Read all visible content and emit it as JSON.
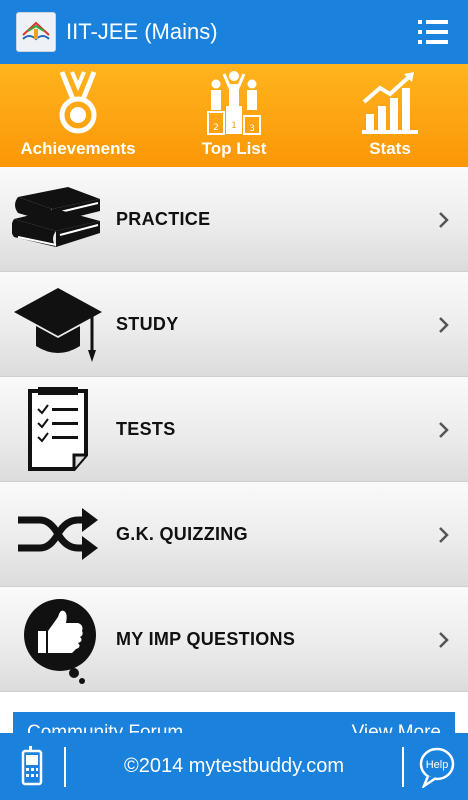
{
  "app": {
    "title": "IIT-JEE (Mains)",
    "colors": {
      "primary": "#1a82dc",
      "accent": "#fb9707",
      "text": "#111111"
    }
  },
  "topnav": {
    "items": [
      {
        "label": "Achievements",
        "icon": "medal-icon"
      },
      {
        "label": "Top List",
        "icon": "podium-icon"
      },
      {
        "label": "Stats",
        "icon": "stats-chart-icon"
      }
    ]
  },
  "menu": {
    "items": [
      {
        "label": "PRACTICE",
        "icon": "books-icon"
      },
      {
        "label": "STUDY",
        "icon": "graduation-cap-icon"
      },
      {
        "label": "TESTS",
        "icon": "clipboard-checklist-icon"
      },
      {
        "label": "G.K. QUIZZING",
        "icon": "shuffle-icon"
      },
      {
        "label": "MY IMP QUESTIONS",
        "icon": "thumbs-up-icon"
      }
    ]
  },
  "community": {
    "title": "Community Forum",
    "more": "View More"
  },
  "footer": {
    "copyright": "©2014 mytestbuddy.com",
    "help_label": "Help"
  }
}
